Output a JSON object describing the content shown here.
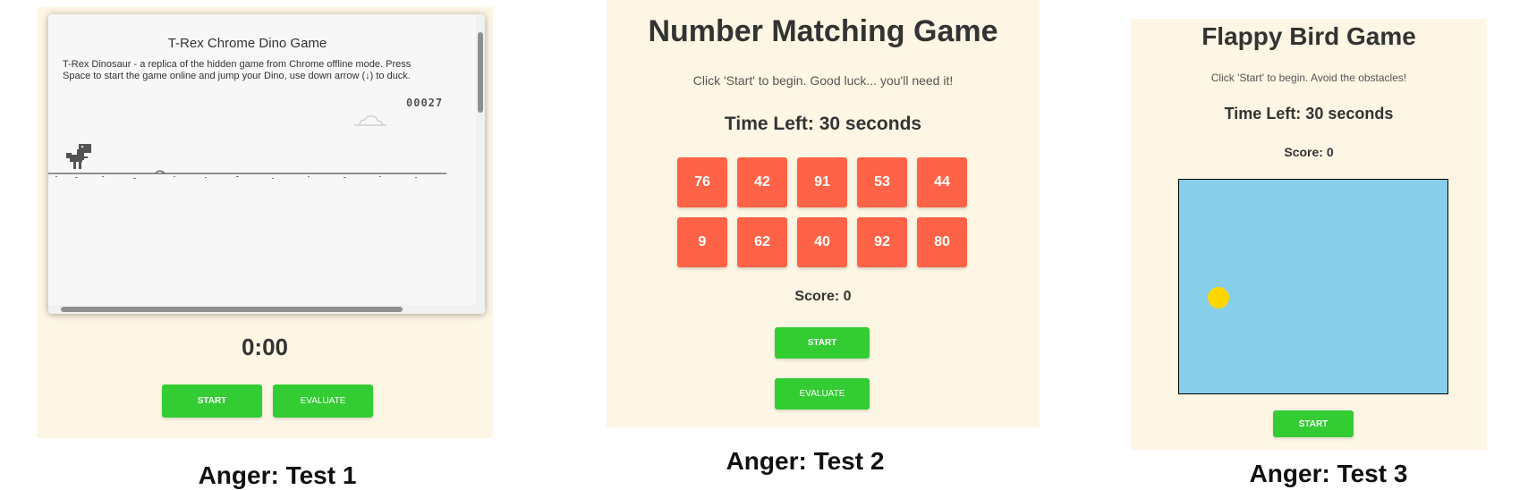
{
  "test1": {
    "title": "T-Rex Chrome Dino Game",
    "description": "T-Rex Dinosaur - a replica of the hidden game from Chrome offline mode. Press Space to start the game online and jump your Dino, use down arrow (↓) to duck.",
    "score": "00027",
    "timer": "0:00",
    "start_label": "START",
    "evaluate_label": "EVALUATE",
    "caption": "Anger: Test 1"
  },
  "test2": {
    "title": "Number Matching Game",
    "instructions": "Click 'Start' to begin. Good luck... you'll need it!",
    "time_left": "Time Left: 30 seconds",
    "tiles_row1": [
      "76",
      "42",
      "91",
      "53",
      "44"
    ],
    "tiles_row2": [
      "9",
      "62",
      "40",
      "92",
      "80"
    ],
    "score": "Score: 0",
    "start_label": "START",
    "evaluate_label": "EVALUATE",
    "caption": "Anger: Test 2"
  },
  "test3": {
    "title": "Flappy Bird Game",
    "instructions": "Click 'Start' to begin. Avoid the obstacles!",
    "time_left": "Time Left: 30 seconds",
    "score": "Score: 0",
    "start_label": "START",
    "caption": "Anger: Test 3"
  },
  "colors": {
    "panel_bg": "#fdf6e4",
    "button_green": "#33cc33",
    "tile_red": "#ff6347",
    "sky_blue": "#87ceeb",
    "bird_yellow": "#ffd700"
  }
}
